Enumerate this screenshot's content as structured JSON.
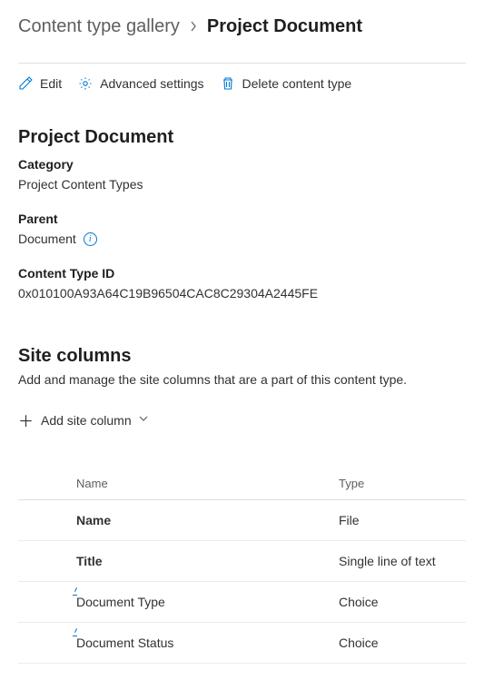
{
  "breadcrumb": {
    "parent": "Content type gallery",
    "current": "Project Document"
  },
  "toolbar": {
    "edit": "Edit",
    "advanced": "Advanced settings",
    "delete": "Delete content type"
  },
  "details": {
    "title": "Project Document",
    "category_label": "Category",
    "category_value": "Project Content Types",
    "parent_label": "Parent",
    "parent_value": "Document",
    "ctid_label": "Content Type ID",
    "ctid_value": "0x010100A93A64C19B96504CAC8C29304A2445FE"
  },
  "site_columns": {
    "title": "Site columns",
    "desc": "Add and manage the site columns that are a part of this content type.",
    "add_label": "Add site column",
    "headers": {
      "name": "Name",
      "type": "Type"
    },
    "rows": [
      {
        "name": "Name",
        "type": "File",
        "bold": true,
        "managed": false
      },
      {
        "name": "Title",
        "type": "Single line of text",
        "bold": true,
        "managed": false
      },
      {
        "name": "Document Type",
        "type": "Choice",
        "bold": false,
        "managed": true
      },
      {
        "name": "Document Status",
        "type": "Choice",
        "bold": false,
        "managed": true
      }
    ]
  }
}
